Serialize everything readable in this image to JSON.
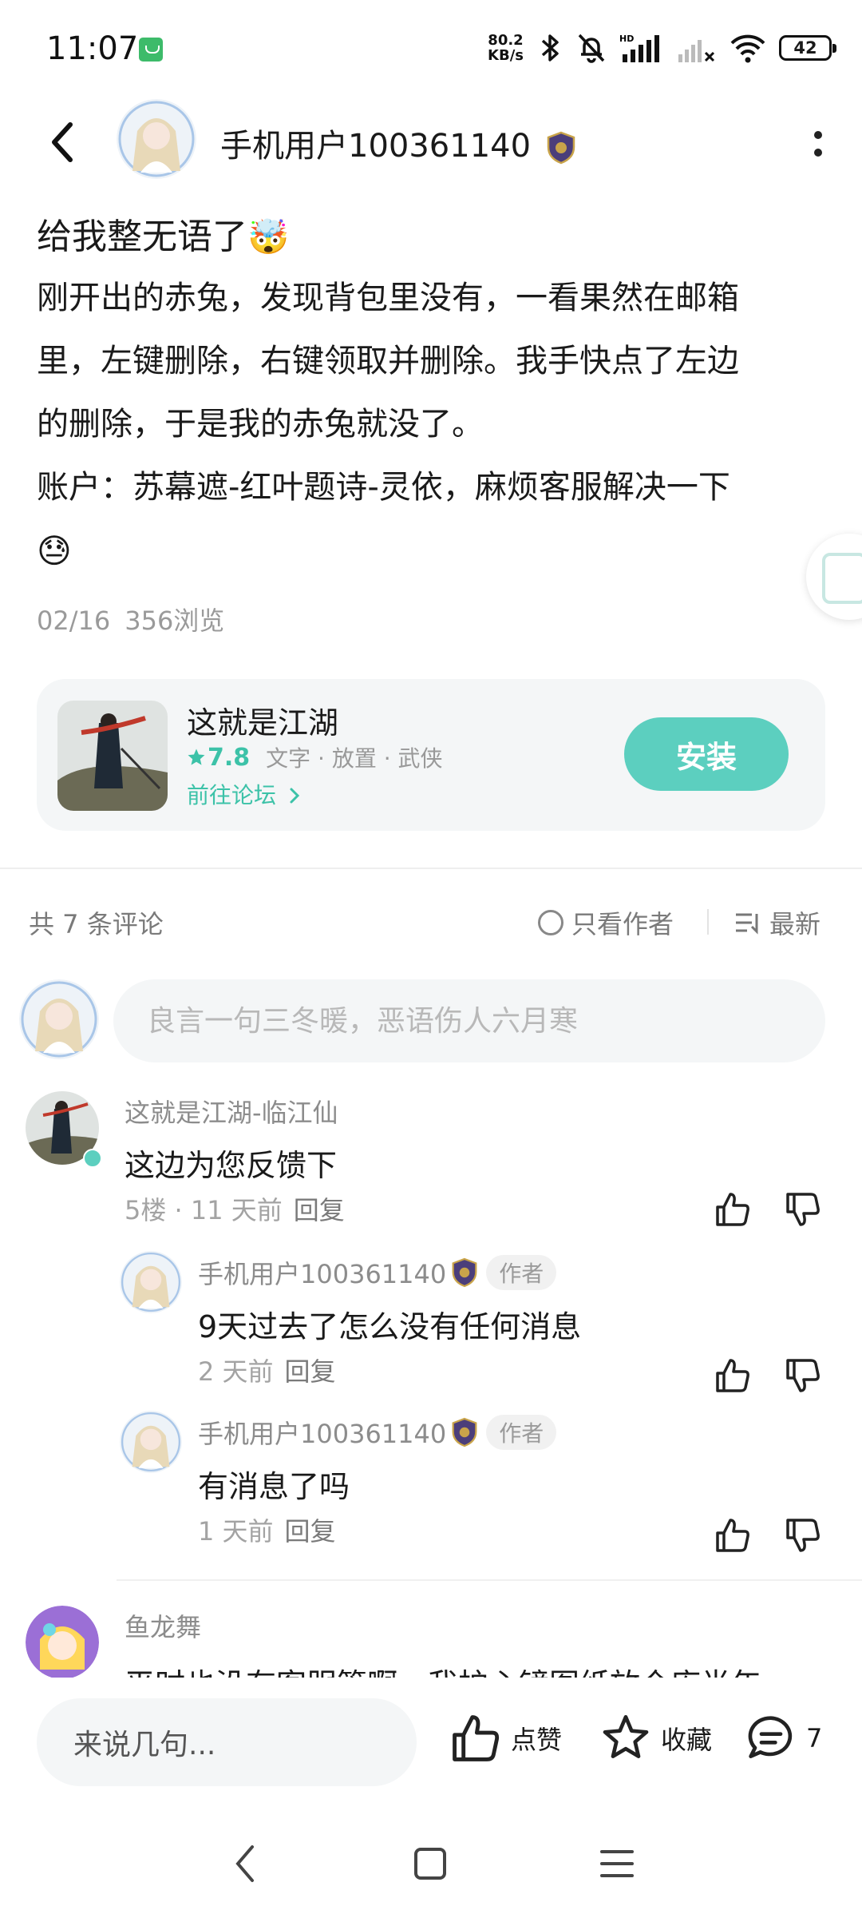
{
  "status_bar": {
    "time": "11:07",
    "net_speed_value": "80.2",
    "net_speed_unit": "KB/s",
    "battery": "42"
  },
  "header": {
    "author_name": "手机用户100361140",
    "back_icon": "chevron-left-icon",
    "more_icon": "more-vertical-icon"
  },
  "post": {
    "title": "给我整无语了",
    "title_emoji": "🤯",
    "body_lines": [
      "刚开出的赤兔，发现背包里没有，一看果然在邮箱",
      "里，左键删除，右键领取并删除。我手快点了左边",
      "的删除，于是我的赤兔就没了。",
      "账户：苏幕遮-红叶题诗-灵依，麻烦客服解决一下"
    ],
    "end_emoji": "😓",
    "date": "02/16",
    "views": "356浏览"
  },
  "game_card": {
    "name": "这就是江湖",
    "score": "7.8",
    "tags": "文字 · 放置 · 武侠",
    "forum_link": "前往论坛",
    "install_label": "安装"
  },
  "comments_bar": {
    "count_label": "共 7 条评论",
    "only_author_label": "只看作者",
    "sort_label": "最新"
  },
  "comment_input": {
    "placeholder": "良言一句三冬暖，恶语伤人六月寒"
  },
  "comments": [
    {
      "user": "这就是江湖-临江仙",
      "text": "这边为您反馈下",
      "floor": "5楼 · 11 天前",
      "reply_label": "回复"
    }
  ],
  "replies": [
    {
      "user": "手机用户100361140",
      "tag": "作者",
      "text": "9天过去了怎么没有任何消息",
      "time": "2 天前",
      "reply_label": "回复"
    },
    {
      "user": "手机用户100361140",
      "tag": "作者",
      "text": "有消息了吗",
      "time": "1 天前",
      "reply_label": "回复"
    }
  ],
  "next_comment": {
    "user": "鱼龙舞",
    "text_partial": "平时也没有客服管啊，我护心镜图纸放仓库半年"
  },
  "bottom_bar": {
    "input_placeholder": "来说几句...",
    "like_label": "点赞",
    "favorite_label": "收藏",
    "comment_count": "7"
  },
  "colors": {
    "accent": "#5ccfbf",
    "accent_text": "#3cc2a8",
    "card_bg": "#f4f6f7",
    "secondary_text": "#9a9a9a"
  }
}
